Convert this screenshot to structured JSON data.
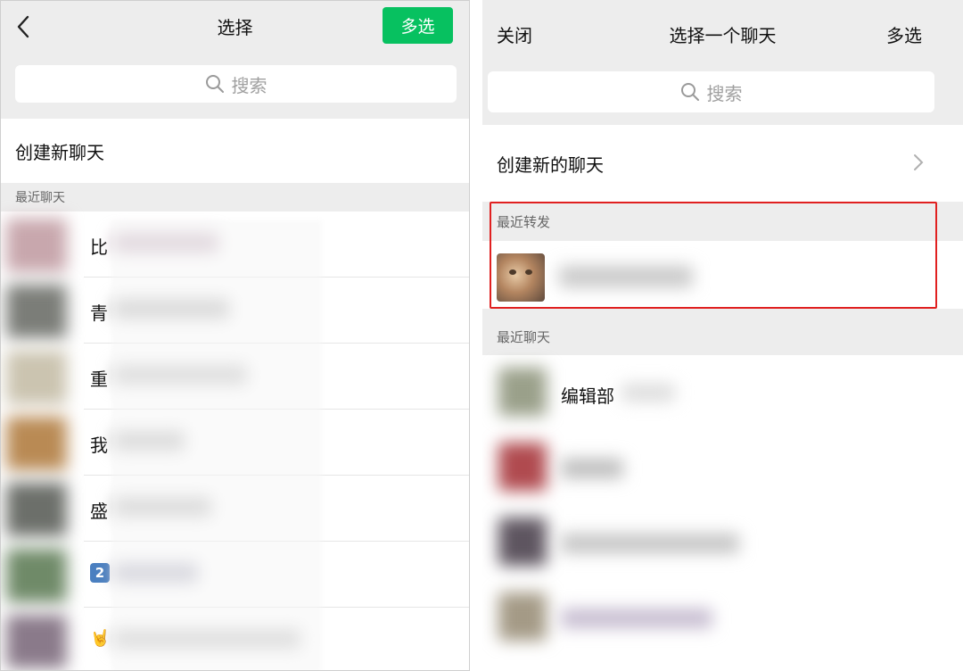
{
  "left_panel": {
    "title": "选择",
    "back_icon": "chevron-left-icon",
    "multi_select_label": "多选",
    "accent_color": "#07c160",
    "search_placeholder": "搜索",
    "create_new_chat_label": "创建新聊天",
    "recent_chats_header": "最近聊天",
    "chats": [
      {
        "prefix": "比",
        "avatar_color": "#c8a7ad"
      },
      {
        "prefix": "青",
        "avatar_color": "#7b7d78"
      },
      {
        "prefix": "重",
        "avatar_color": "#cbc4b0"
      },
      {
        "prefix": "我",
        "avatar_color": "#b98a54"
      },
      {
        "prefix": "盛",
        "avatar_color": "#6c6f6a"
      },
      {
        "prefix": "2",
        "avatar_color": "#6f8a68"
      },
      {
        "prefix": "🤘",
        "avatar_color": "#8a7a8a"
      }
    ]
  },
  "right_panel": {
    "close_label": "关闭",
    "title": "选择一个聊天",
    "multi_select_label": "多选",
    "search_placeholder": "搜索",
    "create_new_chat_label": "创建新的聊天",
    "recent_forwards_header": "最近转发",
    "highlight_color": "#e02020",
    "recent_chats_header": "最近聊天",
    "chats": [
      {
        "name": "编辑部",
        "avatar_color": "#9aa08a"
      },
      {
        "name": "",
        "avatar_color": "#b04a4f"
      },
      {
        "name": "",
        "avatar_color": "#5e5560"
      },
      {
        "name": "",
        "avatar_color": "#a49a86"
      }
    ]
  }
}
